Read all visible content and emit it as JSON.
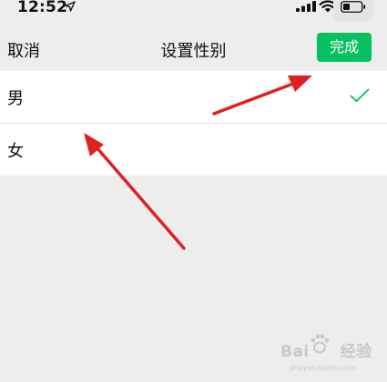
{
  "status_bar": {
    "time": "12:52",
    "icons": [
      "location-arrow-icon",
      "signal-icon",
      "wifi-icon",
      "battery-icon"
    ]
  },
  "nav": {
    "cancel_label": "取消",
    "title": "设置性别",
    "done_label": "完成"
  },
  "options": [
    {
      "label": "男",
      "selected": true
    },
    {
      "label": "女",
      "selected": false
    }
  ],
  "colors": {
    "done_button": "#07c160",
    "check_mark": "#07c160",
    "annotation_arrow": "#e02020",
    "background": "#ededed"
  },
  "watermark": {
    "text_left": "Bai",
    "text_right": "经验",
    "subtext": "jingyan.baidu.com"
  }
}
